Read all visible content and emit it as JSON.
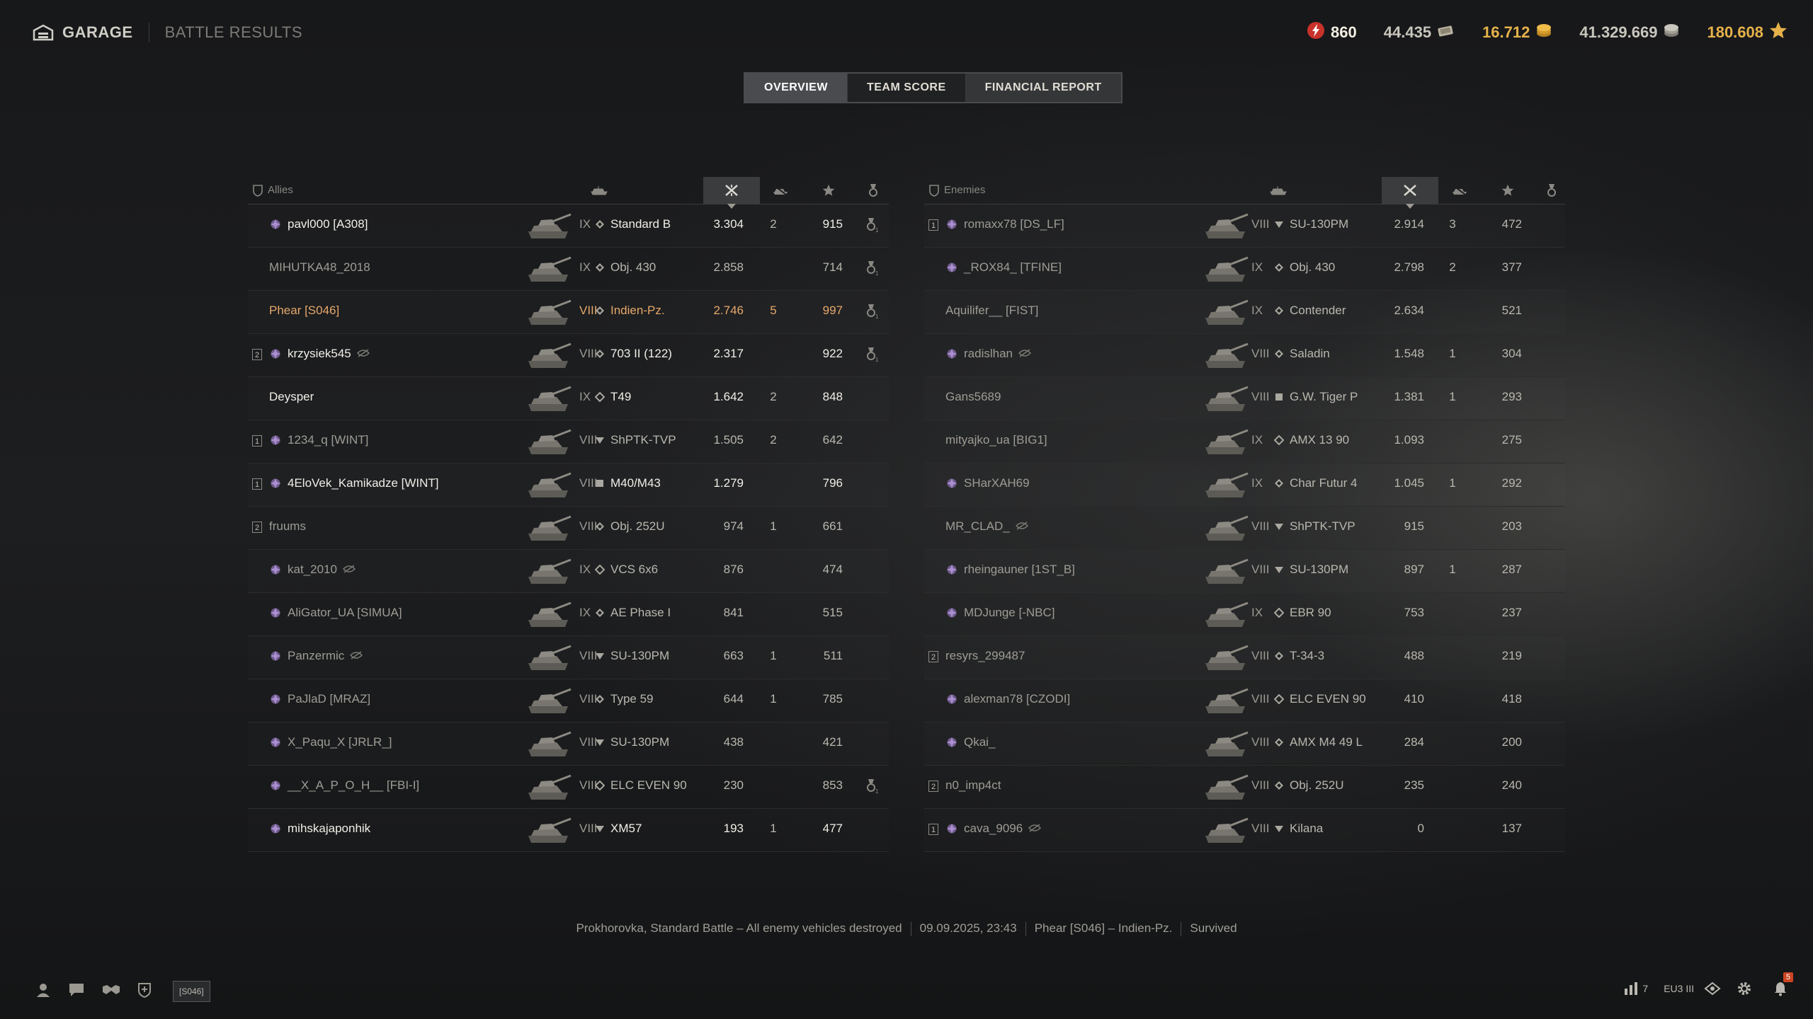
{
  "nav": {
    "garage_label": "GARAGE",
    "results_label": "BATTLE RESULTS"
  },
  "currencies": {
    "energy": "860",
    "bonds": "44.435",
    "gold": "16.712",
    "credits": "41.329.669",
    "free_xp": "180.608"
  },
  "tabs": [
    {
      "label": "OVERVIEW",
      "state": "active"
    },
    {
      "label": "TEAM SCORE",
      "state": "normal"
    },
    {
      "label": "FINANCIAL REPORT",
      "state": "highlighted"
    }
  ],
  "allies": {
    "label": "Allies",
    "rows": [
      {
        "platoon": "",
        "name": "pavl000 [A308]",
        "tier": "IX",
        "cls": "medium",
        "tank": "Standard B",
        "dmg": "3.304",
        "kills": "2",
        "xp": "915",
        "medal": true,
        "style": "bright"
      },
      {
        "platoon": "",
        "name": "MIHUTKA48_2018",
        "tier": "IX",
        "cls": "medium",
        "tank": "Obj. 430",
        "dmg": "2.858",
        "kills": "",
        "xp": "714",
        "medal": true,
        "style": "dim"
      },
      {
        "platoon": "",
        "name": "Phear [S046]",
        "tier": "VIII",
        "cls": "medium",
        "tank": "Indien-Pz.",
        "dmg": "2.746",
        "kills": "5",
        "xp": "997",
        "medal": true,
        "style": "you"
      },
      {
        "platoon": "2",
        "name": "krzysiek545",
        "tier": "VIII",
        "cls": "medium",
        "tank": "703 II (122)",
        "dmg": "2.317",
        "kills": "",
        "xp": "922",
        "medal": true,
        "style": "bright",
        "hidden": true
      },
      {
        "platoon": "",
        "name": "Deysper",
        "tier": "IX",
        "cls": "light",
        "tank": "T49",
        "dmg": "1.642",
        "kills": "2",
        "xp": "848",
        "medal": false,
        "style": "bright"
      },
      {
        "platoon": "1",
        "name": "1234_q [WINT]",
        "tier": "VIII",
        "cls": "td",
        "tank": "ShPTK-TVP",
        "dmg": "1.505",
        "kills": "2",
        "xp": "642",
        "medal": false,
        "style": "dim"
      },
      {
        "platoon": "1",
        "name": "4EloVek_Kamikadze [WINT]",
        "tier": "VIII",
        "cls": "spg",
        "tank": "M40/M43",
        "dmg": "1.279",
        "kills": "",
        "xp": "796",
        "medal": false,
        "style": "bright"
      },
      {
        "platoon": "2",
        "name": "fruums",
        "tier": "VIII",
        "cls": "medium",
        "tank": "Obj. 252U",
        "dmg": "974",
        "kills": "1",
        "xp": "661",
        "medal": false,
        "style": "dim"
      },
      {
        "platoon": "",
        "name": "kat_2010",
        "tier": "IX",
        "cls": "light",
        "tank": "VCS 6x6",
        "dmg": "876",
        "kills": "",
        "xp": "474",
        "medal": false,
        "style": "dim",
        "hidden": true
      },
      {
        "platoon": "",
        "name": "AliGator_UA [SIMUA]",
        "tier": "IX",
        "cls": "medium",
        "tank": "AE Phase I",
        "dmg": "841",
        "kills": "",
        "xp": "515",
        "medal": false,
        "style": "dim"
      },
      {
        "platoon": "",
        "name": "Panzermic",
        "tier": "VIII",
        "cls": "td",
        "tank": "SU-130PM",
        "dmg": "663",
        "kills": "1",
        "xp": "511",
        "medal": false,
        "style": "dim",
        "hidden": true
      },
      {
        "platoon": "",
        "name": "PaJlaD [MRAZ]",
        "tier": "VIII",
        "cls": "medium",
        "tank": "Type 59",
        "dmg": "644",
        "kills": "1",
        "xp": "785",
        "medal": false,
        "style": "dim"
      },
      {
        "platoon": "",
        "name": "X_Paqu_X [JRLR_]",
        "tier": "VIII",
        "cls": "td",
        "tank": "SU-130PM",
        "dmg": "438",
        "kills": "",
        "xp": "421",
        "medal": false,
        "style": "dim"
      },
      {
        "platoon": "",
        "name": "__X_A_P_O_H__ [FBI-I]",
        "tier": "VIII",
        "cls": "light",
        "tank": "ELC EVEN 90",
        "dmg": "230",
        "kills": "",
        "xp": "853",
        "medal": true,
        "style": "dim"
      },
      {
        "platoon": "",
        "name": "mihskajaponhik",
        "tier": "VIII",
        "cls": "td",
        "tank": "XM57",
        "dmg": "193",
        "kills": "1",
        "xp": "477",
        "medal": false,
        "style": "bright"
      }
    ]
  },
  "enemies": {
    "label": "Enemies",
    "rows": [
      {
        "platoon": "1",
        "name": "romaxx78 [DS_LF]",
        "tier": "VIII",
        "cls": "td",
        "tank": "SU-130PM",
        "dmg": "2.914",
        "kills": "3",
        "xp": "472",
        "style": "dim"
      },
      {
        "platoon": "",
        "name": "_ROX84_ [TFINE]",
        "tier": "IX",
        "cls": "medium",
        "tank": "Obj. 430",
        "dmg": "2.798",
        "kills": "2",
        "xp": "377",
        "style": "dim"
      },
      {
        "platoon": "",
        "name": "Aquilifer__ [FIST]",
        "tier": "IX",
        "cls": "medium",
        "tank": "Contender",
        "dmg": "2.634",
        "kills": "",
        "xp": "521",
        "style": "dim"
      },
      {
        "platoon": "",
        "name": "radislhan",
        "tier": "VIII",
        "cls": "medium",
        "tank": "Saladin",
        "dmg": "1.548",
        "kills": "1",
        "xp": "304",
        "style": "dim",
        "hidden": true
      },
      {
        "platoon": "",
        "name": "Gans5689",
        "tier": "VIII",
        "cls": "spg",
        "tank": "G.W. Tiger P",
        "dmg": "1.381",
        "kills": "1",
        "xp": "293",
        "style": "dim"
      },
      {
        "platoon": "",
        "name": "mityajko_ua [BIG1]",
        "tier": "IX",
        "cls": "light",
        "tank": "AMX 13 90",
        "dmg": "1.093",
        "kills": "",
        "xp": "275",
        "style": "dim"
      },
      {
        "platoon": "",
        "name": "SHarXAH69",
        "tier": "IX",
        "cls": "medium",
        "tank": "Char Futur 4",
        "dmg": "1.045",
        "kills": "1",
        "xp": "292",
        "style": "dim"
      },
      {
        "platoon": "",
        "name": "MR_CLAD_",
        "tier": "VIII",
        "cls": "td",
        "tank": "ShPTK-TVP",
        "dmg": "915",
        "kills": "",
        "xp": "203",
        "style": "dim",
        "hidden": true
      },
      {
        "platoon": "",
        "name": "rheingauner [1ST_B]",
        "tier": "VIII",
        "cls": "td",
        "tank": "SU-130PM",
        "dmg": "897",
        "kills": "1",
        "xp": "287",
        "style": "dim"
      },
      {
        "platoon": "",
        "name": "MDJunge [-NBC]",
        "tier": "IX",
        "cls": "light",
        "tank": "EBR 90",
        "dmg": "753",
        "kills": "",
        "xp": "237",
        "style": "dim"
      },
      {
        "platoon": "2",
        "name": "resyrs_299487",
        "tier": "VIII",
        "cls": "medium",
        "tank": "T-34-3",
        "dmg": "488",
        "kills": "",
        "xp": "219",
        "style": "dim"
      },
      {
        "platoon": "",
        "name": "alexman78 [CZODI]",
        "tier": "VIII",
        "cls": "light",
        "tank": "ELC EVEN 90",
        "dmg": "410",
        "kills": "",
        "xp": "418",
        "style": "dim"
      },
      {
        "platoon": "",
        "name": "Qkai_",
        "tier": "VIII",
        "cls": "medium",
        "tank": "AMX M4 49 L",
        "dmg": "284",
        "kills": "",
        "xp": "200",
        "style": "dim"
      },
      {
        "platoon": "2",
        "name": "n0_imp4ct",
        "tier": "VIII",
        "cls": "medium",
        "tank": "Obj. 252U",
        "dmg": "235",
        "kills": "",
        "xp": "240",
        "style": "dim"
      },
      {
        "platoon": "1",
        "name": "cava_9096",
        "tier": "VIII",
        "cls": "td",
        "tank": "Kilana",
        "dmg": "0",
        "kills": "",
        "xp": "137",
        "style": "dim",
        "hidden": true
      }
    ]
  },
  "summary": {
    "map_mode": "Prokhorovka, Standard Battle – All enemy vehicles destroyed",
    "datetime": "09.09.2025, 23:43",
    "player": "Phear [S046] – Indien-Pz.",
    "status": "Survived"
  },
  "bottom": {
    "clan_tag": "[S046]",
    "server_count": "7",
    "server": "EU3 III",
    "notifications": "5"
  },
  "colors": {
    "accent_gold": "#e6b24a",
    "you_orange": "#e6a86a"
  }
}
